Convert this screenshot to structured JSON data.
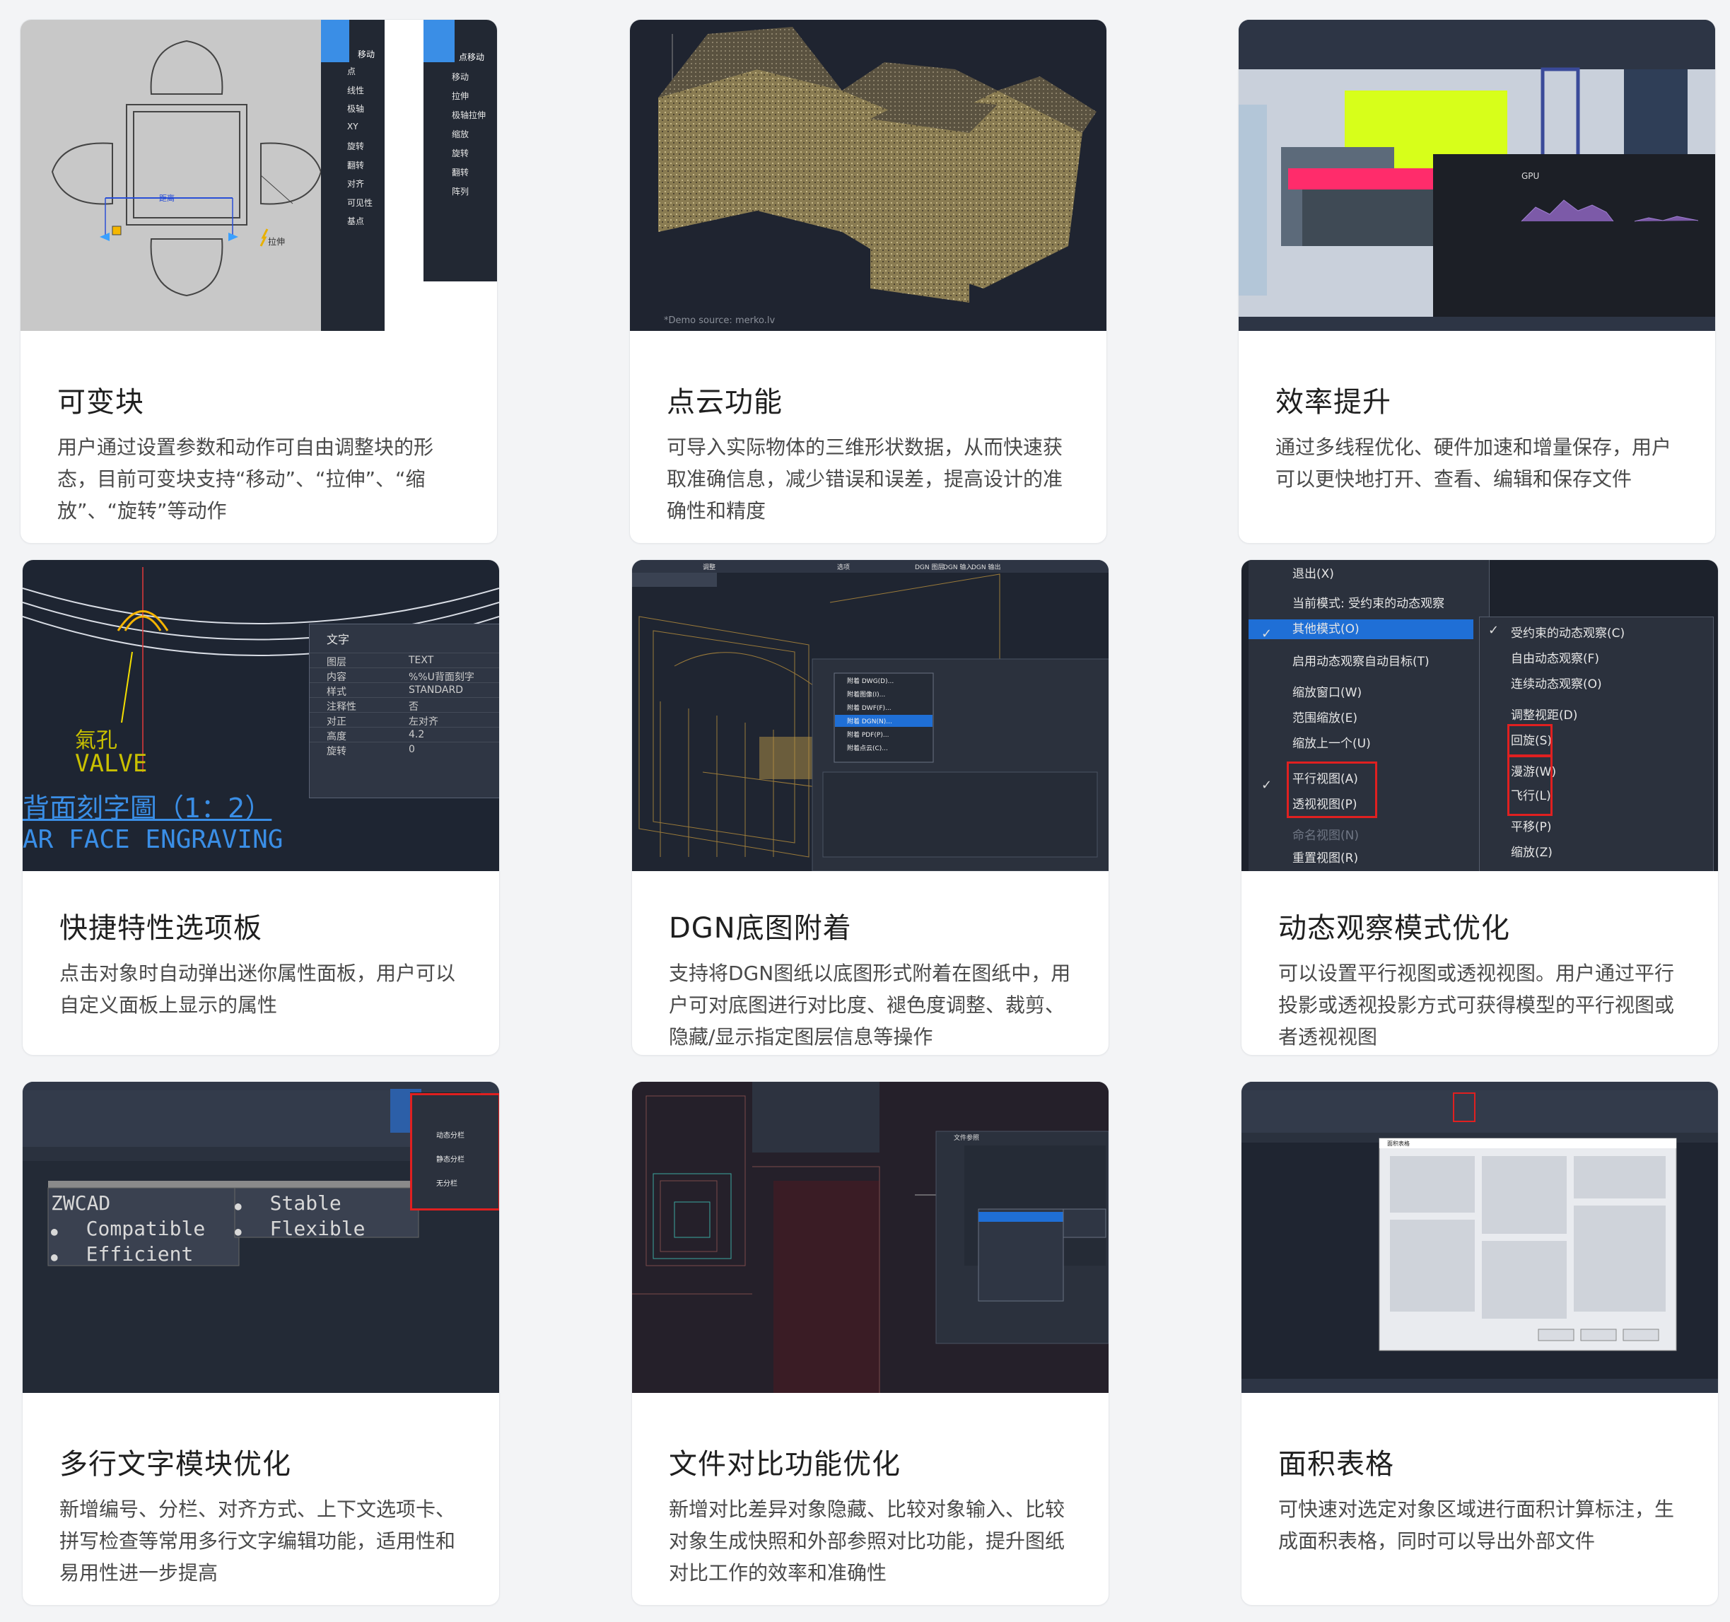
{
  "cards": [
    {
      "title": "可变块",
      "desc": "用户通过设置参数和动作可自由调整块的形态，目前可变块支持“移动”、“拉伸”、“缩放”、“旋转”等动作",
      "img": {
        "dist_label": "距离",
        "stretch_label": "拉伸",
        "tools_left": [
          "点",
          "线性",
          "极轴",
          "XY",
          "旋转",
          "翻转",
          "对齐",
          "可见性",
          "基点"
        ],
        "tools_top_left": [
          "移动"
        ],
        "tools_right": [
          "移动",
          "拉伸",
          "极轴拉伸",
          "缩放",
          "旋转",
          "翻转",
          "阵列"
        ],
        "tools_top_right": [
          "点移动"
        ]
      }
    },
    {
      "title": "点云功能",
      "desc": "可导入实际物体的三维形状数据，从而快速获取准确信息，减少错误和误差，提高设计的准确性和精度",
      "img": {
        "source": "*Demo source: merko.lv"
      }
    },
    {
      "title": "效率提升",
      "desc": "通过多线程优化、硬件加速和增量保存，用户可以更快地打开、查看、编辑和保存文件",
      "img": {
        "gpu_label": "GPU"
      }
    },
    {
      "title": "快捷特性选项板",
      "desc": "点击对象时自动弹出迷你属性面板，用户可以自定义面板上显示的属性",
      "img": {
        "valve_cn": "氣孔",
        "valve_en": "VALVE",
        "engrave_cn": "背面刻字圖（1：2）",
        "engrave_en": "AR FACE ENGRAVING",
        "panel_title": "文字",
        "rows": [
          [
            "图层",
            "TEXT"
          ],
          [
            "内容",
            "%%U背面刻字"
          ],
          [
            "样式",
            "STANDARD"
          ],
          [
            "注释性",
            "否"
          ],
          [
            "对正",
            "左对齐"
          ],
          [
            "高度",
            "4.2"
          ],
          [
            "旋转",
            "0"
          ]
        ]
      }
    },
    {
      "title": "DGN底图附着",
      "desc": "支持将DGN图纸以底图形式附着在图纸中，用户可对底图进行对比度、褪色度调整、裁剪、隐藏/显示指定图层信息等操作",
      "img": {
        "menu": [
          "附着 DWG(D)...",
          "附着图像(I)...",
          "附着 DWF(F)...",
          "附着 DGN(N)...",
          "附着 PDF(P)...",
          "附着点云(C)..."
        ],
        "tabs": [
          "调整",
          "选项",
          "DGN 图层",
          "DGN 输入",
          "DGN 输出"
        ]
      }
    },
    {
      "title": "动态观察模式优化",
      "desc": "可以设置平行视图或透视视图。用户通过平行投影或透视投影方式可获得模型的平行视图或者透视视图",
      "img": {
        "left_menu": [
          "退出(X)",
          "当前模式: 受约束的动态观察",
          "其他模式(O)",
          "启用动态观察自动目标(T)",
          "缩放窗口(W)",
          "范围缩放(E)",
          "缩放上一个(U)",
          "平行视图(A)",
          "透视视图(P)",
          "命名视图(N)",
          "重置视图(R)"
        ],
        "right_menu": [
          "受约束的动态观察(C)",
          "自由动态观察(F)",
          "连续动态观察(O)",
          "调整视距(D)",
          "回旋(S)",
          "漫游(W)",
          "飞行(L)",
          "平移(P)",
          "缩放(Z)"
        ]
      }
    },
    {
      "title": "多行文字模块优化",
      "desc": "新增编号、分栏、对齐方式、上下文选项卡、拼写检查等常用多行文字编辑功能，适用性和易用性进一步提高",
      "img": {
        "col1": [
          "ZWCAD",
          "Compatible",
          "Efficient"
        ],
        "col2": [
          "Stable",
          "Flexible"
        ],
        "menu": [
          "动态分栏",
          "静态分栏",
          "无分栏"
        ]
      }
    },
    {
      "title": "文件对比功能优化",
      "desc": "新增对比差异对象隐藏、比较对象输入、比较对象生成快照和外部参照对比功能，提升图纸对比工作的效率和准确性",
      "img": {
        "panel_title": "文件参照"
      }
    },
    {
      "title": "面积表格",
      "desc": "可快速对选定对象区域进行面积计算标注，生成面积表格，同时可以导出外部文件",
      "img": {
        "dialog_title": "面积表格"
      }
    }
  ]
}
